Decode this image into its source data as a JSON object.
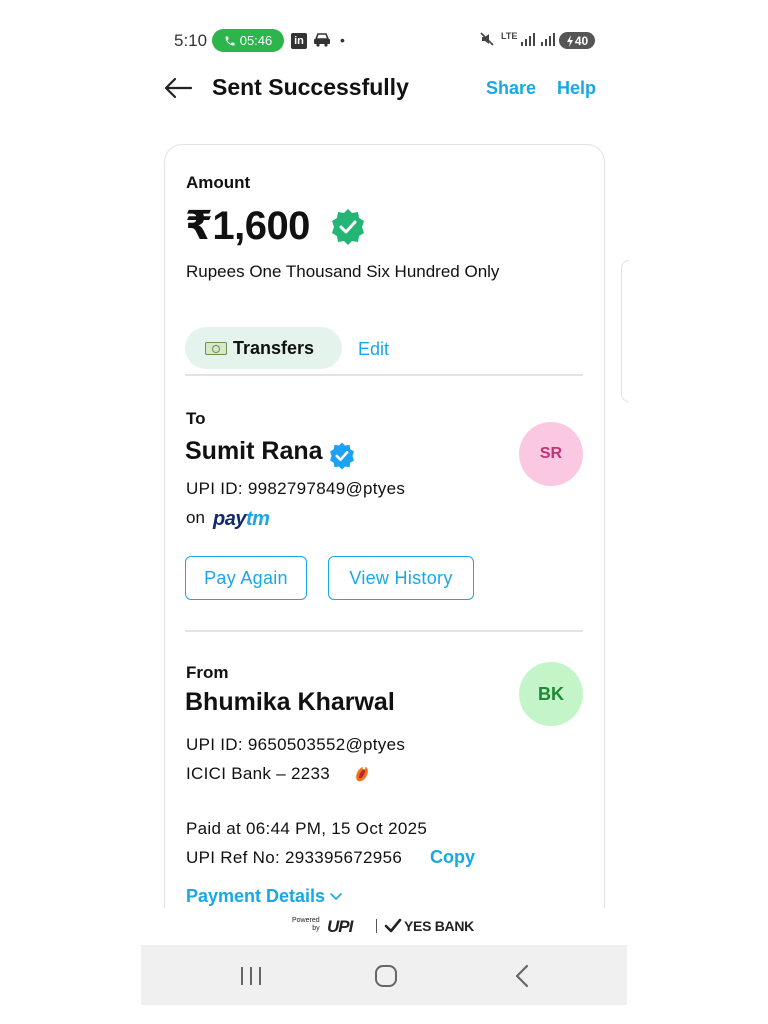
{
  "status_bar": {
    "time": "5:10",
    "call_duration": "05:46",
    "linkedin_glyph": "in",
    "battery": "40",
    "network": "LTE",
    "icons": [
      "phone-icon",
      "linkedin-icon",
      "car-icon",
      "mute-icon",
      "signal-icon",
      "battery-charging-icon"
    ]
  },
  "header": {
    "title": "Sent Successfully",
    "share_label": "Share",
    "help_label": "Help"
  },
  "amount": {
    "label": "Amount",
    "value": "₹1,600",
    "words": "Rupees One Thousand Six Hundred Only"
  },
  "category": {
    "chip_label": "Transfers",
    "edit_label": "Edit"
  },
  "to": {
    "label": "To",
    "name": "Sumit Rana",
    "upi_id": "UPI ID: 9982797849@ptyes",
    "on_label": "on",
    "app_pay": "pay",
    "app_tm": "tm",
    "avatar_initials": "SR",
    "pay_again_label": "Pay Again",
    "view_history_label": "View History"
  },
  "from": {
    "label": "From",
    "name": "Bhumika Kharwal",
    "upi_id": "UPI ID: 9650503552@ptyes",
    "bank": "ICICI Bank – 2233",
    "avatar_initials": "BK"
  },
  "transaction": {
    "paid_at": "Paid at 06:44 PM, 15 Oct 2025",
    "ref_no": "UPI Ref No: 293395672956",
    "copy_label": "Copy",
    "payment_details_label": "Payment Details"
  },
  "footer": {
    "powered_line1": "Powered",
    "powered_line2": "by",
    "upi_text": "UPI",
    "bank_text": "YES BANK"
  },
  "colors": {
    "accent": "#19a8e6",
    "success": "#2bb54a",
    "verified_green": "#22b573",
    "chip_bg": "#e4f4ec",
    "avatar_sr_bg": "#fbc8e2",
    "avatar_bk_bg": "#c4f5c8"
  }
}
